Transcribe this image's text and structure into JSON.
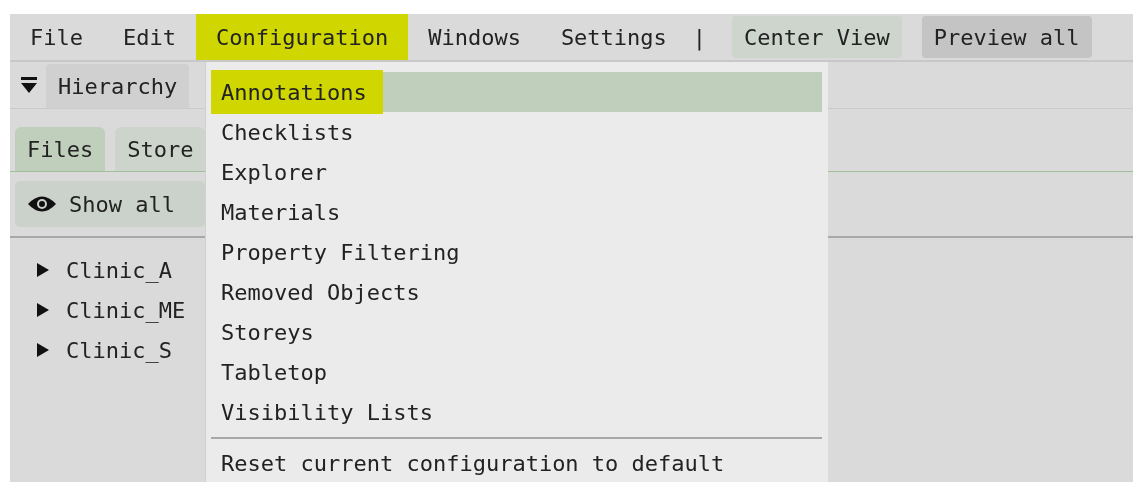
{
  "menubar": {
    "items": [
      {
        "label": "File",
        "selected": false
      },
      {
        "label": "Edit",
        "selected": false
      },
      {
        "label": "Configuration",
        "selected": true
      },
      {
        "label": "Windows",
        "selected": false
      },
      {
        "label": "Settings",
        "selected": false
      }
    ],
    "separator": "|",
    "buttons": [
      {
        "label": "Center View",
        "kind": "view"
      },
      {
        "label": "Preview all",
        "kind": "preview"
      }
    ]
  },
  "panel": {
    "title_tab": "Hierarchy",
    "tabs": [
      {
        "label": "Files",
        "selected": true
      },
      {
        "label": "Store",
        "selected": false
      }
    ],
    "show_button": "Show all",
    "tree": [
      {
        "label": "Clinic_A",
        "expanded": false
      },
      {
        "label": "Clinic_ME",
        "expanded": false
      },
      {
        "label": "Clinic_S",
        "expanded": false
      }
    ]
  },
  "dropdown": {
    "items": [
      {
        "label": "Annotations",
        "selected": true
      },
      {
        "label": "Checklists",
        "selected": false
      },
      {
        "label": "Explorer",
        "selected": false
      },
      {
        "label": "Materials",
        "selected": false
      },
      {
        "label": "Property Filtering",
        "selected": false
      },
      {
        "label": "Removed Objects",
        "selected": false
      },
      {
        "label": "Storeys",
        "selected": false
      },
      {
        "label": "Tabletop",
        "selected": false
      },
      {
        "label": "Visibility Lists",
        "selected": false
      }
    ],
    "footer_items": [
      {
        "label": "Reset current configuration to default"
      }
    ]
  }
}
